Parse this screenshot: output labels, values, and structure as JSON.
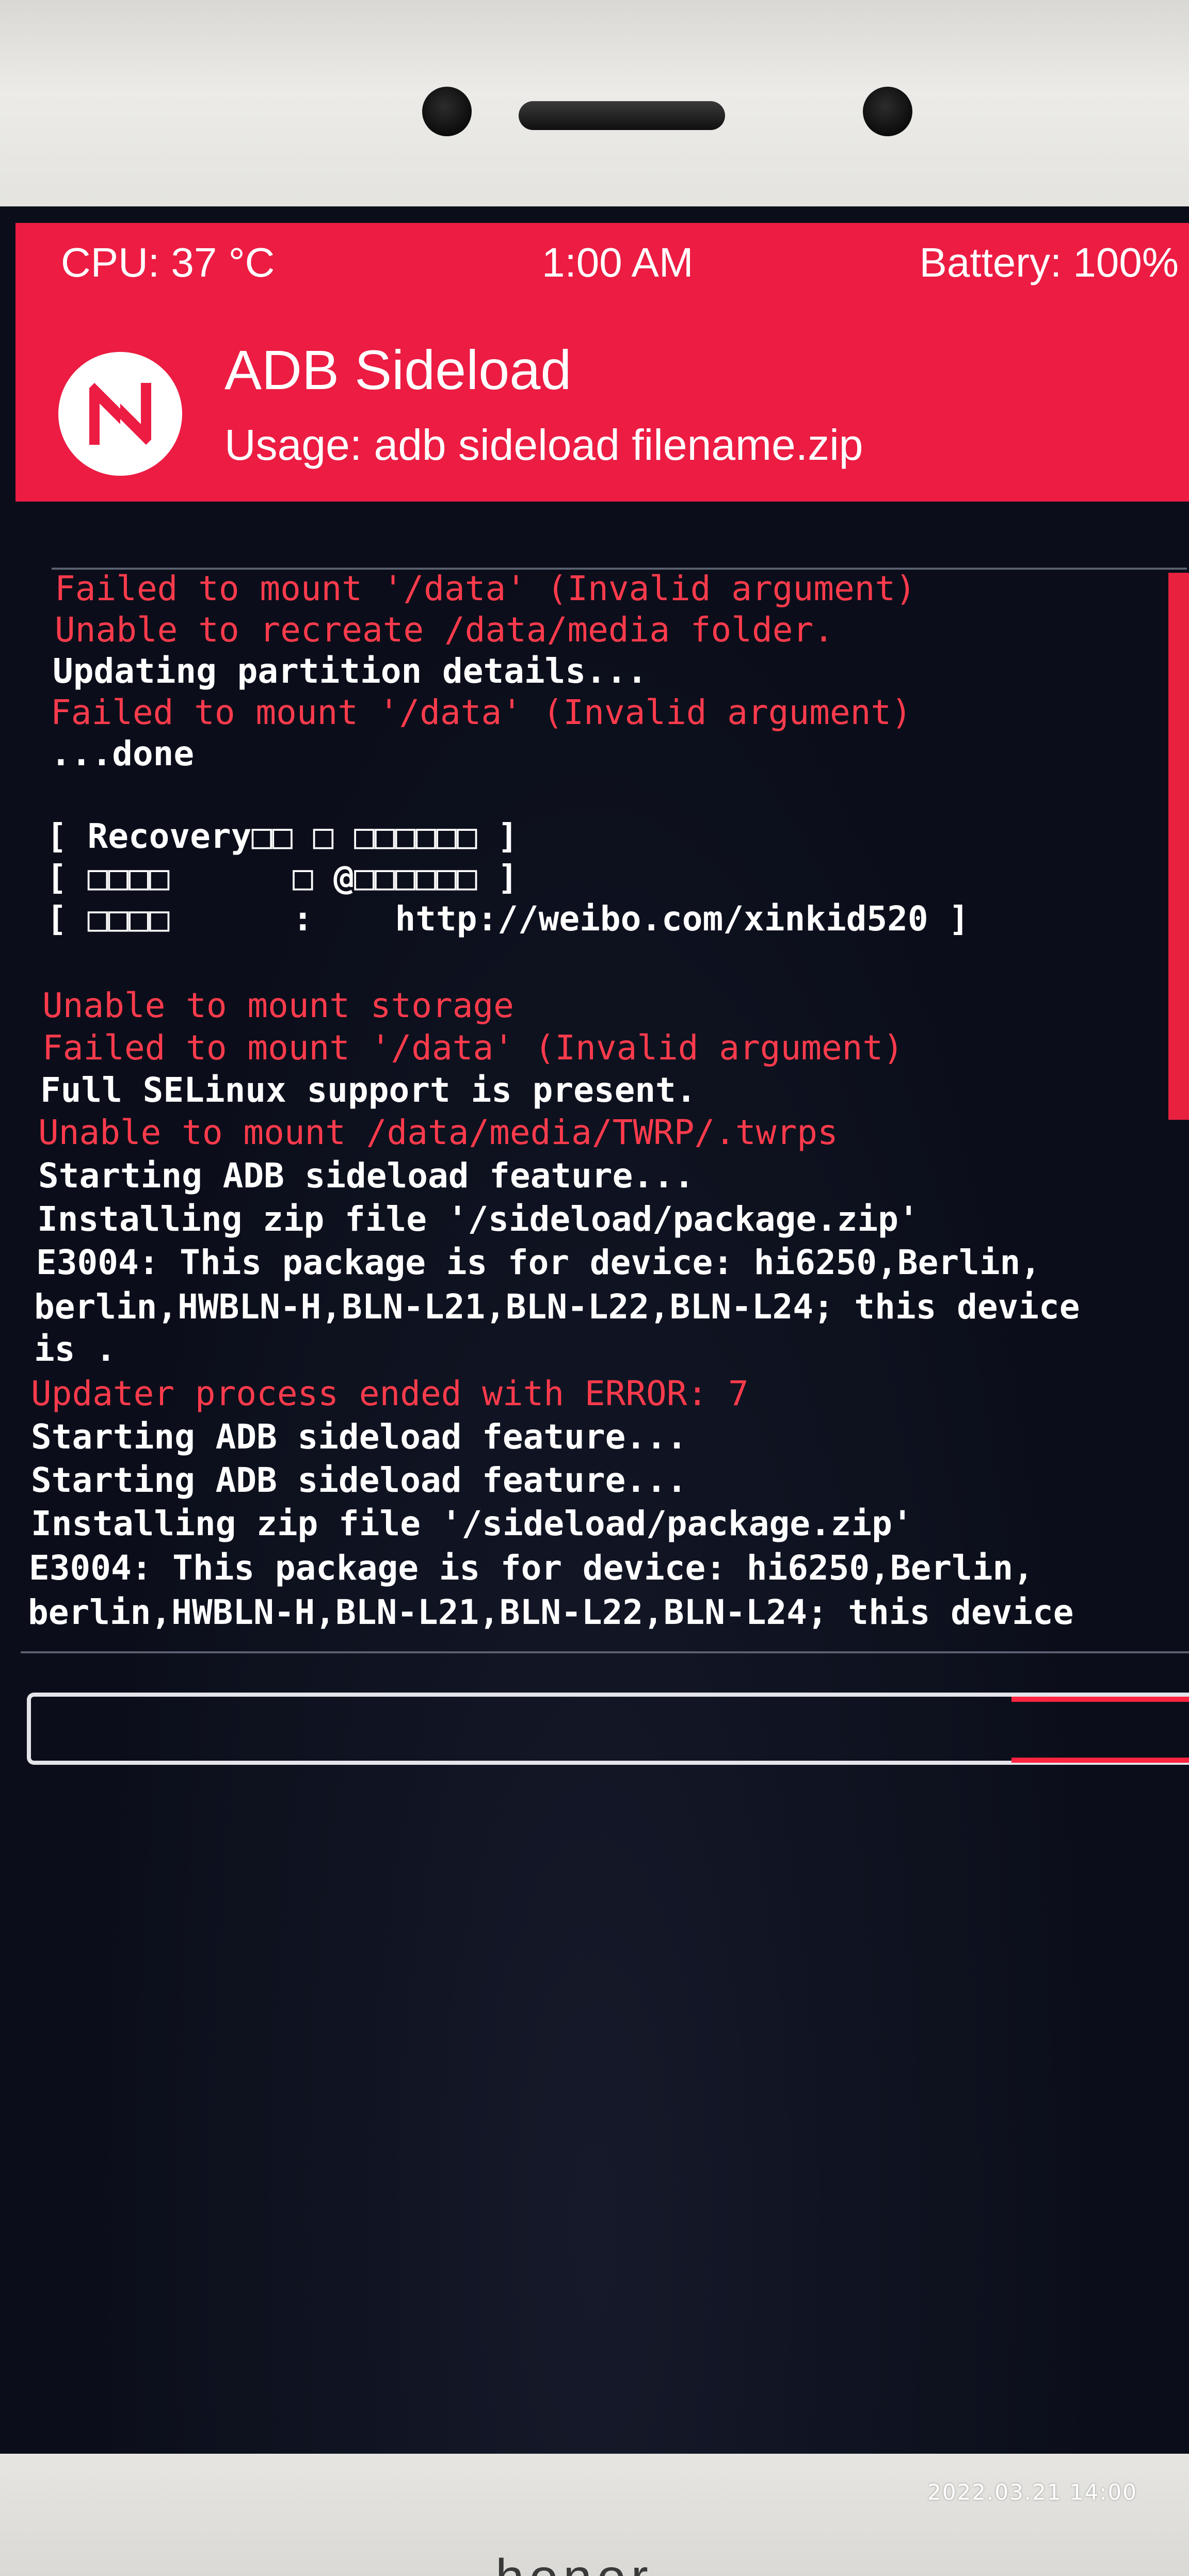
{
  "status_bar": {
    "cpu": "CPU: 37 °C",
    "time": "1:00 AM",
    "battery": "Battery: 100%"
  },
  "header": {
    "title": "ADB Sideload",
    "subtitle": "Usage: adb sideload filename.zip"
  },
  "colors": {
    "accent": "#ec1c43",
    "console_background": "#0b0e1a",
    "error_text": "#ff3b4c",
    "normal_text": "#ffffff"
  },
  "console": {
    "lines": [
      {
        "text": "Failed to mount '/data' (Invalid argument)",
        "type": "error"
      },
      {
        "text": "Unable to recreate /data/media folder.",
        "type": "error"
      },
      {
        "text": "Updating partition details...",
        "type": "normal"
      },
      {
        "text": "Failed to mount '/data' (Invalid argument)",
        "type": "error"
      },
      {
        "text": "...done",
        "type": "normal"
      },
      {
        "text": "",
        "type": "normal"
      },
      {
        "text": "[ Recovery□□ □ □□□□□□ ]",
        "type": "normal"
      },
      {
        "text": "[ □□□□      □ @□□□□□□ ]",
        "type": "normal"
      },
      {
        "text": "[ □□□□      :    http://weibo.com/xinkid520 ]",
        "type": "normal"
      },
      {
        "text": "",
        "type": "normal"
      },
      {
        "text": "Unable to mount storage",
        "type": "error"
      },
      {
        "text": "Failed to mount '/data' (Invalid argument)",
        "type": "error"
      },
      {
        "text": "Full SELinux support is present.",
        "type": "normal"
      },
      {
        "text": "Unable to mount /data/media/TWRP/.twrps",
        "type": "error"
      },
      {
        "text": "Starting ADB sideload feature...",
        "type": "normal"
      },
      {
        "text": "Installing zip file '/sideload/package.zip'",
        "type": "normal"
      },
      {
        "text": "E3004: This package is for device: hi6250,Berlin,",
        "type": "normal"
      },
      {
        "text": "berlin,HWBLN-H,BLN-L21,BLN-L22,BLN-L24; this device",
        "type": "normal"
      },
      {
        "text": "is .",
        "type": "normal"
      },
      {
        "text": "Updater process ended with ERROR: 7",
        "type": "error"
      },
      {
        "text": "Starting ADB sideload feature...",
        "type": "normal"
      },
      {
        "text": "Starting ADB sideload feature...",
        "type": "normal"
      },
      {
        "text": "Installing zip file '/sideload/package.zip'",
        "type": "normal"
      },
      {
        "text": "E3004: This package is for device: hi6250,Berlin,",
        "type": "normal"
      },
      {
        "text": "berlin,HWBLN-H,BLN-L21,BLN-L22,BLN-L24; this device",
        "type": "normal"
      }
    ]
  },
  "photo_stamp": "2022.03.21  14:00",
  "brand_text": "honor"
}
